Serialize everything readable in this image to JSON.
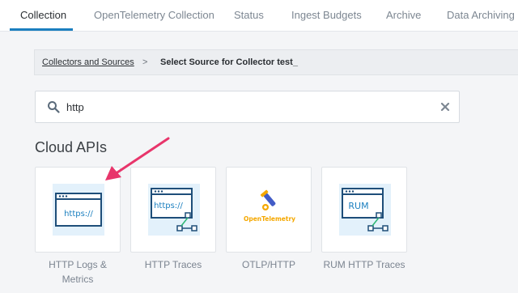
{
  "tabs": [
    {
      "label": "Collection",
      "active": true
    },
    {
      "label": "OpenTelemetry Collection",
      "active": false
    },
    {
      "label": "Status",
      "active": false
    },
    {
      "label": "Ingest Budgets",
      "active": false
    },
    {
      "label": "Archive",
      "active": false
    },
    {
      "label": "Data Archiving",
      "active": false
    }
  ],
  "breadcrumb": {
    "link": "Collectors and Sources",
    "separator": ">",
    "current": "Select Source for Collector test_"
  },
  "search": {
    "value": "http",
    "icon": "search-icon",
    "clear_icon": "close-icon"
  },
  "section": {
    "title": "Cloud APIs"
  },
  "cards": [
    {
      "label_line1": "HTTP Logs &",
      "label_line2": "Metrics",
      "icon_text": "https://"
    },
    {
      "label_line1": "HTTP Traces",
      "label_line2": "",
      "icon_text": "https://"
    },
    {
      "label_line1": "OTLP/HTTP",
      "label_line2": "",
      "icon_text": "OpenTelemetry"
    },
    {
      "label_line1": "RUM HTTP Traces",
      "label_line2": "",
      "icon_text": "RUM"
    }
  ],
  "colors": {
    "accent": "#1b7fbf",
    "arrow": "#e8356b",
    "tile_bg": "#e3f1fb",
    "otel_orange": "#f5a800",
    "otel_blue": "#425cc7"
  }
}
